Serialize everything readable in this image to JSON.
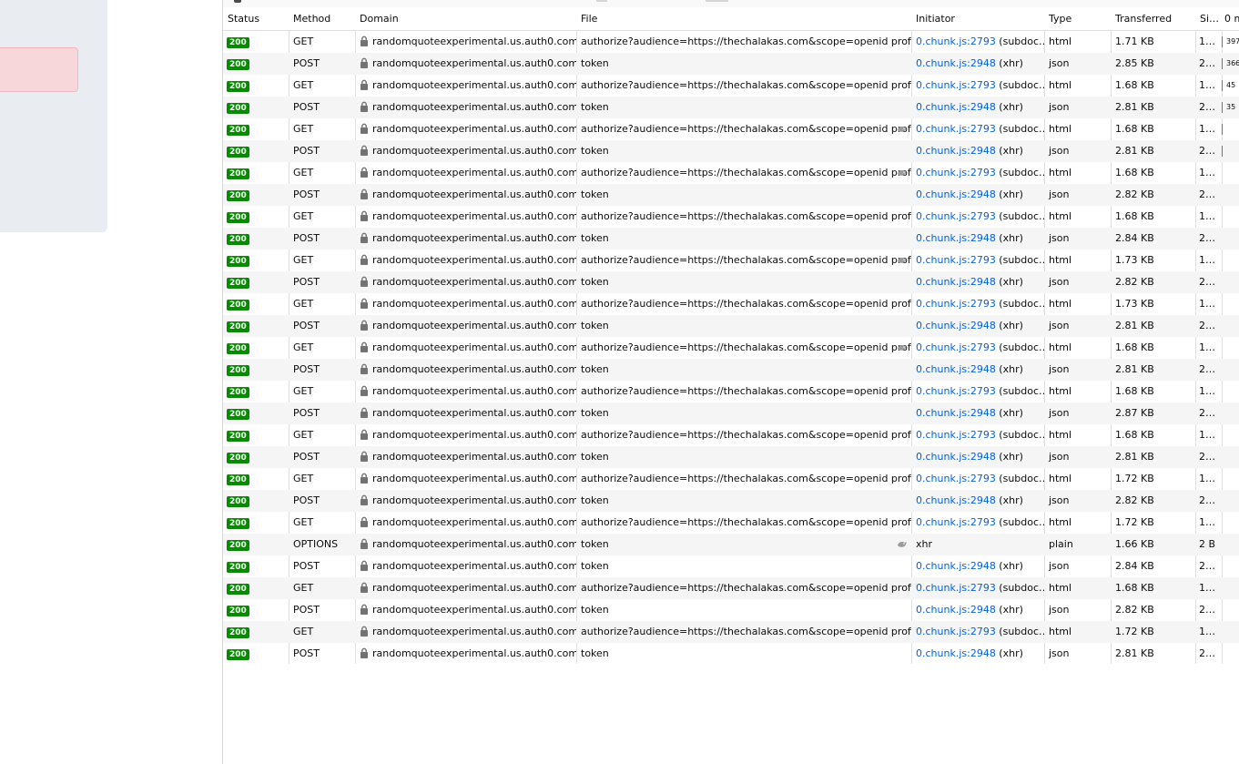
{
  "headers": {
    "status": "Status",
    "method": "Method",
    "domain": "Domain",
    "file": "File",
    "initiator": "Initiator",
    "type": "Type",
    "transferred": "Transferred",
    "size": "Si…",
    "waterfall": "0 m"
  },
  "colors": {
    "status_ok": "#058b00",
    "link": "#0060df",
    "row_alt": "#f5f5f6",
    "left_card": "#e9ecf0",
    "alert_box": "#f8d7da"
  },
  "icons": {
    "lock": "lock-icon",
    "tracker": "tracker-icon"
  },
  "rows": [
    {
      "status": "200",
      "method": "GET",
      "domain": "randomquoteexperimental.us.auth0.com",
      "file": "authorize?audience=https://thechalakas.com&scope=openid profile e",
      "tracker": false,
      "init_link": "0.chunk.js:2793",
      "init_rest": " (subdoc…",
      "type": "html",
      "transferred": "1.71 KB",
      "size": "1…",
      "waterfall": "397"
    },
    {
      "status": "200",
      "method": "POST",
      "domain": "randomquoteexperimental.us.auth0.com",
      "file": "token",
      "tracker": false,
      "init_link": "0.chunk.js:2948",
      "init_rest": " (xhr)",
      "type": "json",
      "transferred": "2.85 KB",
      "size": "2…",
      "waterfall": "366"
    },
    {
      "status": "200",
      "method": "GET",
      "domain": "randomquoteexperimental.us.auth0.com",
      "file": "authorize?audience=https://thechalakas.com&scope=openid profile e",
      "tracker": false,
      "init_link": "0.chunk.js:2793",
      "init_rest": " (subdoc…",
      "type": "html",
      "transferred": "1.68 KB",
      "size": "1…",
      "waterfall": "45"
    },
    {
      "status": "200",
      "method": "POST",
      "domain": "randomquoteexperimental.us.auth0.com",
      "file": "token",
      "tracker": false,
      "init_link": "0.chunk.js:2948",
      "init_rest": " (xhr)",
      "type": "json",
      "transferred": "2.81 KB",
      "size": "2…",
      "waterfall": "35"
    },
    {
      "status": "200",
      "method": "GET",
      "domain": "randomquoteexperimental.us.auth0.com",
      "file": "authorize?audience=https://thechalakas.com&scope=openid prof",
      "tracker": true,
      "init_link": "0.chunk.js:2793",
      "init_rest": " (subdoc…",
      "type": "html",
      "transferred": "1.68 KB",
      "size": "1…",
      "waterfall": ""
    },
    {
      "status": "200",
      "method": "POST",
      "domain": "randomquoteexperimental.us.auth0.com",
      "file": "token",
      "tracker": false,
      "init_link": "0.chunk.js:2948",
      "init_rest": " (xhr)",
      "type": "json",
      "transferred": "2.81 KB",
      "size": "2…",
      "waterfall": ""
    },
    {
      "status": "200",
      "method": "GET",
      "domain": "randomquoteexperimental.us.auth0.com",
      "file": "authorize?audience=https://thechalakas.com&scope=openid prof",
      "tracker": true,
      "init_link": "0.chunk.js:2793",
      "init_rest": " (subdoc…",
      "type": "html",
      "transferred": "1.68 KB",
      "size": "1…",
      "waterfall": ""
    },
    {
      "status": "200",
      "method": "POST",
      "domain": "randomquoteexperimental.us.auth0.com",
      "file": "token",
      "tracker": false,
      "init_link": "0.chunk.js:2948",
      "init_rest": " (xhr)",
      "type": "json",
      "transferred": "2.82 KB",
      "size": "2…",
      "waterfall": ""
    },
    {
      "status": "200",
      "method": "GET",
      "domain": "randomquoteexperimental.us.auth0.com",
      "file": "authorize?audience=https://thechalakas.com&scope=openid profile e",
      "tracker": false,
      "init_link": "0.chunk.js:2793",
      "init_rest": " (subdoc…",
      "type": "html",
      "transferred": "1.68 KB",
      "size": "1…",
      "waterfall": ""
    },
    {
      "status": "200",
      "method": "POST",
      "domain": "randomquoteexperimental.us.auth0.com",
      "file": "token",
      "tracker": false,
      "init_link": "0.chunk.js:2948",
      "init_rest": " (xhr)",
      "type": "json",
      "transferred": "2.84 KB",
      "size": "2…",
      "waterfall": ""
    },
    {
      "status": "200",
      "method": "GET",
      "domain": "randomquoteexperimental.us.auth0.com",
      "file": "authorize?audience=https://thechalakas.com&scope=openid prof",
      "tracker": true,
      "init_link": "0.chunk.js:2793",
      "init_rest": " (subdoc…",
      "type": "html",
      "transferred": "1.73 KB",
      "size": "1…",
      "waterfall": ""
    },
    {
      "status": "200",
      "method": "POST",
      "domain": "randomquoteexperimental.us.auth0.com",
      "file": "token",
      "tracker": false,
      "init_link": "0.chunk.js:2948",
      "init_rest": " (xhr)",
      "type": "json",
      "transferred": "2.82 KB",
      "size": "2…",
      "waterfall": ""
    },
    {
      "status": "200",
      "method": "GET",
      "domain": "randomquoteexperimental.us.auth0.com",
      "file": "authorize?audience=https://thechalakas.com&scope=openid profile e",
      "tracker": false,
      "init_link": "0.chunk.js:2793",
      "init_rest": " (subdoc…",
      "type": "html",
      "transferred": "1.73 KB",
      "size": "1…",
      "waterfall": ""
    },
    {
      "status": "200",
      "method": "POST",
      "domain": "randomquoteexperimental.us.auth0.com",
      "file": "token",
      "tracker": false,
      "init_link": "0.chunk.js:2948",
      "init_rest": " (xhr)",
      "type": "json",
      "transferred": "2.81 KB",
      "size": "2…",
      "waterfall": ""
    },
    {
      "status": "200",
      "method": "GET",
      "domain": "randomquoteexperimental.us.auth0.com",
      "file": "authorize?audience=https://thechalakas.com&scope=openid prof",
      "tracker": true,
      "init_link": "0.chunk.js:2793",
      "init_rest": " (subdoc…",
      "type": "html",
      "transferred": "1.68 KB",
      "size": "1…",
      "waterfall": ""
    },
    {
      "status": "200",
      "method": "POST",
      "domain": "randomquoteexperimental.us.auth0.com",
      "file": "token",
      "tracker": false,
      "init_link": "0.chunk.js:2948",
      "init_rest": " (xhr)",
      "type": "json",
      "transferred": "2.81 KB",
      "size": "2…",
      "waterfall": ""
    },
    {
      "status": "200",
      "method": "GET",
      "domain": "randomquoteexperimental.us.auth0.com",
      "file": "authorize?audience=https://thechalakas.com&scope=openid profile e",
      "tracker": false,
      "init_link": "0.chunk.js:2793",
      "init_rest": " (subdoc…",
      "type": "html",
      "transferred": "1.68 KB",
      "size": "1…",
      "waterfall": ""
    },
    {
      "status": "200",
      "method": "POST",
      "domain": "randomquoteexperimental.us.auth0.com",
      "file": "token",
      "tracker": false,
      "init_link": "0.chunk.js:2948",
      "init_rest": " (xhr)",
      "type": "json",
      "transferred": "2.87 KB",
      "size": "2…",
      "waterfall": ""
    },
    {
      "status": "200",
      "method": "GET",
      "domain": "randomquoteexperimental.us.auth0.com",
      "file": "authorize?audience=https://thechalakas.com&scope=openid profile e",
      "tracker": false,
      "init_link": "0.chunk.js:2793",
      "init_rest": " (subdoc…",
      "type": "html",
      "transferred": "1.68 KB",
      "size": "1…",
      "waterfall": ""
    },
    {
      "status": "200",
      "method": "POST",
      "domain": "randomquoteexperimental.us.auth0.com",
      "file": "token",
      "tracker": false,
      "init_link": "0.chunk.js:2948",
      "init_rest": " (xhr)",
      "type": "json",
      "transferred": "2.81 KB",
      "size": "2…",
      "waterfall": ""
    },
    {
      "status": "200",
      "method": "GET",
      "domain": "randomquoteexperimental.us.auth0.com",
      "file": "authorize?audience=https://thechalakas.com&scope=openid profile e",
      "tracker": false,
      "init_link": "0.chunk.js:2793",
      "init_rest": " (subdoc…",
      "type": "html",
      "transferred": "1.72 KB",
      "size": "1…",
      "waterfall": ""
    },
    {
      "status": "200",
      "method": "POST",
      "domain": "randomquoteexperimental.us.auth0.com",
      "file": "token",
      "tracker": false,
      "init_link": "0.chunk.js:2948",
      "init_rest": " (xhr)",
      "type": "json",
      "transferred": "2.82 KB",
      "size": "2…",
      "waterfall": ""
    },
    {
      "status": "200",
      "method": "GET",
      "domain": "randomquoteexperimental.us.auth0.com",
      "file": "authorize?audience=https://thechalakas.com&scope=openid profile e",
      "tracker": false,
      "init_link": "0.chunk.js:2793",
      "init_rest": " (subdoc…",
      "type": "html",
      "transferred": "1.72 KB",
      "size": "1…",
      "waterfall": ""
    },
    {
      "status": "200",
      "method": "OPTIONS",
      "domain": "randomquoteexperimental.us.auth0.com",
      "file": "token",
      "tracker": true,
      "init_link": "",
      "init_rest": "xhr",
      "type": "plain",
      "transferred": "1.66 KB",
      "size": "2 B",
      "waterfall": ""
    },
    {
      "status": "200",
      "method": "POST",
      "domain": "randomquoteexperimental.us.auth0.com",
      "file": "token",
      "tracker": false,
      "init_link": "0.chunk.js:2948",
      "init_rest": " (xhr)",
      "type": "json",
      "transferred": "2.84 KB",
      "size": "2…",
      "waterfall": ""
    },
    {
      "status": "200",
      "method": "GET",
      "domain": "randomquoteexperimental.us.auth0.com",
      "file": "authorize?audience=https://thechalakas.com&scope=openid profile e",
      "tracker": false,
      "init_link": "0.chunk.js:2793",
      "init_rest": " (subdoc…",
      "type": "html",
      "transferred": "1.68 KB",
      "size": "1…",
      "waterfall": ""
    },
    {
      "status": "200",
      "method": "POST",
      "domain": "randomquoteexperimental.us.auth0.com",
      "file": "token",
      "tracker": false,
      "init_link": "0.chunk.js:2948",
      "init_rest": " (xhr)",
      "type": "json",
      "transferred": "2.82 KB",
      "size": "2…",
      "waterfall": ""
    },
    {
      "status": "200",
      "method": "GET",
      "domain": "randomquoteexperimental.us.auth0.com",
      "file": "authorize?audience=https://thechalakas.com&scope=openid profile e",
      "tracker": false,
      "init_link": "0.chunk.js:2793",
      "init_rest": " (subdoc…",
      "type": "html",
      "transferred": "1.72 KB",
      "size": "1…",
      "waterfall": ""
    },
    {
      "status": "200",
      "method": "POST",
      "domain": "randomquoteexperimental.us.auth0.com",
      "file": "token",
      "tracker": false,
      "init_link": "0.chunk.js:2948",
      "init_rest": " (xhr)",
      "type": "json",
      "transferred": "2.81 KB",
      "size": "2…",
      "waterfall": ""
    }
  ]
}
